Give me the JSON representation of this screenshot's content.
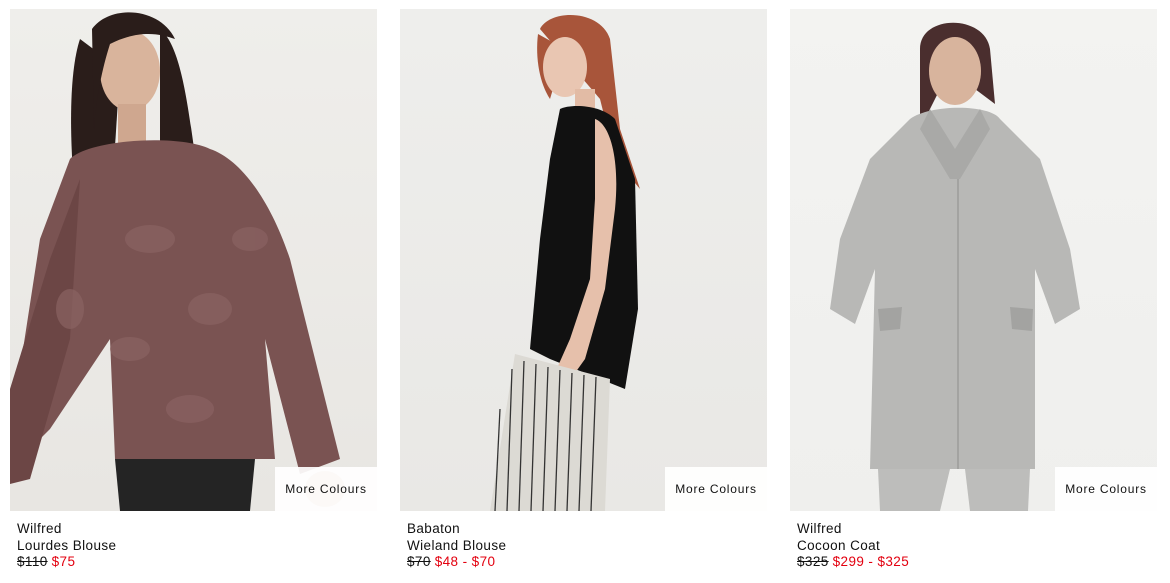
{
  "products": [
    {
      "brand": "Wilfred",
      "name": "Lourdes Blouse",
      "original_price": "$110",
      "sale_price": "$75",
      "more_colours_label": "More Colours",
      "garment_color": "#7a5352"
    },
    {
      "brand": "Babaton",
      "name": "Wieland Blouse",
      "original_price": "$70",
      "sale_price": "$48 - $70",
      "more_colours_label": "More Colours",
      "garment_color": "#111111"
    },
    {
      "brand": "Wilfred",
      "name": "Cocoon Coat",
      "original_price": "$325",
      "sale_price": "$299 - $325",
      "more_colours_label": "More Colours",
      "garment_color": "#b8b8b6"
    }
  ],
  "colors": {
    "sale": "#e3000f",
    "text": "#111111"
  }
}
